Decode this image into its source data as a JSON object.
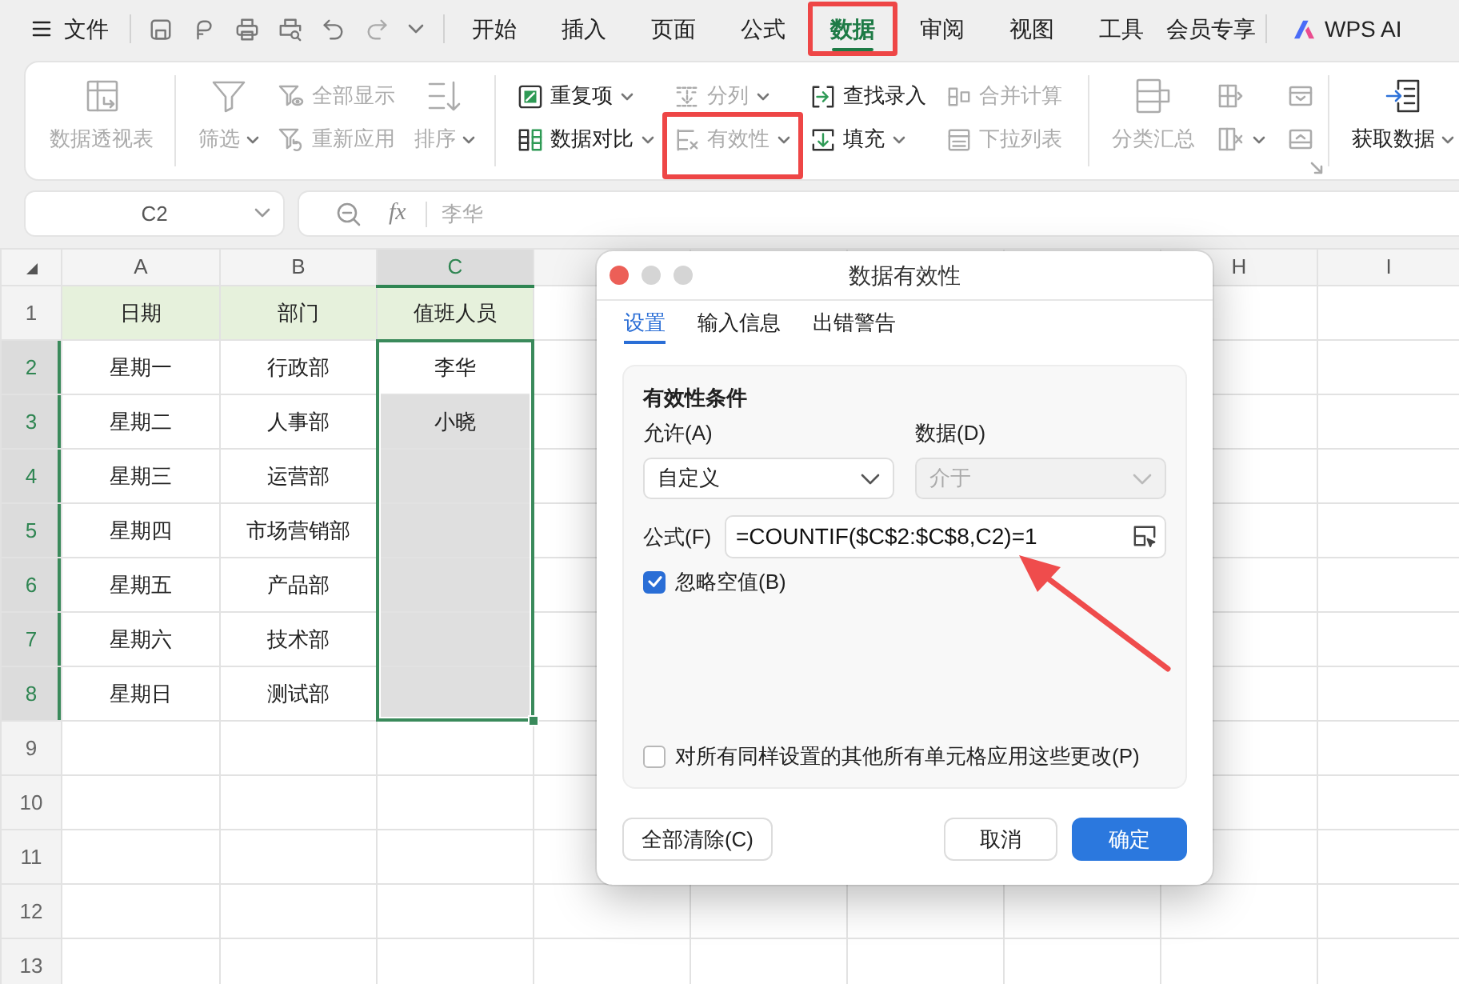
{
  "menu_bar": {
    "file_label": "文件",
    "tabs": [
      {
        "label": "开始",
        "selected": false,
        "highlighted": false
      },
      {
        "label": "插入",
        "selected": false,
        "highlighted": false
      },
      {
        "label": "页面",
        "selected": false,
        "highlighted": false
      },
      {
        "label": "公式",
        "selected": false,
        "highlighted": false
      },
      {
        "label": "数据",
        "selected": true,
        "highlighted": true
      },
      {
        "label": "审阅",
        "selected": false,
        "highlighted": false
      },
      {
        "label": "视图",
        "selected": false,
        "highlighted": false
      },
      {
        "label": "工具",
        "selected": false,
        "highlighted": false
      },
      {
        "label": "会员专享",
        "selected": false,
        "highlighted": false
      }
    ],
    "ai_label": "WPS AI"
  },
  "ribbon": {
    "groups": [
      {
        "launcher": false,
        "columns": [
          {
            "kind": "large",
            "items": [
              {
                "label": "数据透视表",
                "disabled": true,
                "has_menu": false,
                "highlighted": false
              }
            ]
          }
        ]
      },
      {
        "launcher": false,
        "columns": [
          {
            "kind": "large",
            "items": [
              {
                "label": "筛选",
                "disabled": true,
                "has_menu": true,
                "highlighted": false
              }
            ]
          },
          {
            "kind": "stack",
            "items": [
              {
                "label": "全部显示",
                "disabled": true,
                "has_menu": false,
                "highlighted": false
              },
              {
                "label": "重新应用",
                "disabled": true,
                "has_menu": false,
                "highlighted": false
              }
            ]
          },
          {
            "kind": "large",
            "items": [
              {
                "label": "排序",
                "disabled": true,
                "has_menu": true,
                "highlighted": false
              }
            ]
          }
        ]
      },
      {
        "launcher": false,
        "columns": [
          {
            "kind": "stack",
            "items": [
              {
                "label": "重复项",
                "disabled": false,
                "has_menu": true,
                "highlighted": false
              },
              {
                "label": "数据对比",
                "disabled": false,
                "has_menu": true,
                "highlighted": false
              }
            ]
          },
          {
            "kind": "stack",
            "items": [
              {
                "label": "分列",
                "disabled": true,
                "has_menu": true,
                "highlighted": false
              },
              {
                "label": "有效性",
                "disabled": true,
                "has_menu": true,
                "highlighted": true
              }
            ]
          },
          {
            "kind": "stack",
            "items": [
              {
                "label": "查找录入",
                "disabled": false,
                "has_menu": false,
                "highlighted": false
              },
              {
                "label": "填充",
                "disabled": false,
                "has_menu": true,
                "highlighted": false
              }
            ]
          },
          {
            "kind": "stack",
            "items": [
              {
                "label": "合并计算",
                "disabled": true,
                "has_menu": false,
                "highlighted": false
              },
              {
                "label": "下拉列表",
                "disabled": true,
                "has_menu": false,
                "highlighted": false
              }
            ]
          }
        ]
      },
      {
        "launcher": true,
        "columns": [
          {
            "kind": "large",
            "items": [
              {
                "label": "分类汇总",
                "disabled": true,
                "has_menu": false,
                "highlighted": false
              }
            ]
          },
          {
            "kind": "stack",
            "items": [
              {
                "disabled": true,
                "has_menu": false,
                "highlighted": false
              },
              {
                "disabled": true,
                "has_menu": true,
                "highlighted": false
              }
            ]
          },
          {
            "kind": "stack",
            "items": [
              {
                "disabled": true,
                "has_menu": false,
                "highlighted": false
              },
              {
                "disabled": true,
                "has_menu": false,
                "highlighted": false
              }
            ]
          }
        ]
      },
      {
        "launcher": false,
        "columns": [
          {
            "kind": "large",
            "items": [
              {
                "label": "获取数据",
                "disabled": false,
                "has_menu": true,
                "highlighted": false
              }
            ]
          }
        ]
      }
    ]
  },
  "name_box": {
    "value": "C2"
  },
  "formula_bar": {
    "function_label": "fx",
    "value": "李华"
  },
  "grid": {
    "columns": [
      {
        "label": "A",
        "selected": false
      },
      {
        "label": "B",
        "selected": false
      },
      {
        "label": "C",
        "selected": true
      },
      {
        "selected": false
      },
      {
        "selected": false
      },
      {
        "selected": false
      },
      {
        "selected": false
      },
      {
        "label": "H",
        "selected": false
      },
      {
        "label": "I",
        "selected": false
      }
    ],
    "header_row": {
      "number": "1",
      "selected": false,
      "cells": [
        "日期",
        "部门",
        "值班人员"
      ]
    },
    "rows": [
      {
        "number": "2",
        "selected": true,
        "cells": [
          "星期一",
          "行政部",
          "李华"
        ]
      },
      {
        "number": "3",
        "selected": true,
        "cells": [
          "星期二",
          "人事部",
          "小晓"
        ]
      },
      {
        "number": "4",
        "selected": true,
        "cells": [
          "星期三",
          "运营部"
        ]
      },
      {
        "number": "5",
        "selected": true,
        "cells": [
          "星期四",
          "市场营销部"
        ]
      },
      {
        "number": "6",
        "selected": true,
        "cells": [
          "星期五",
          "产品部"
        ]
      },
      {
        "number": "7",
        "selected": true,
        "cells": [
          "星期六",
          "技术部"
        ]
      },
      {
        "number": "8",
        "selected": true,
        "cells": [
          "星期日",
          "测试部"
        ]
      },
      {
        "number": "9",
        "selected": false
      },
      {
        "number": "10",
        "selected": false
      },
      {
        "number": "11",
        "selected": false
      },
      {
        "number": "12",
        "selected": false
      },
      {
        "number": "13",
        "selected": false
      }
    ]
  },
  "dialog": {
    "title": "数据有效性",
    "tabs": [
      {
        "label": "设置",
        "selected": true
      },
      {
        "label": "输入信息",
        "selected": false
      },
      {
        "label": "出错警告",
        "selected": false
      }
    ],
    "section_title": "有效性条件",
    "allow": {
      "label": "允许(A)",
      "value": "自定义",
      "disabled": false
    },
    "data": {
      "label": "数据(D)",
      "value": "介于",
      "disabled": true
    },
    "formula": {
      "label": "公式(F)",
      "value": "=COUNTIF($C$2:$C$8,C2)=1",
      "arrow_annotation": true
    },
    "options": [
      {
        "label": "忽略空值(B)",
        "checked": true
      },
      {
        "label": "对所有同样设置的其他所有单元格应用这些更改(P)",
        "checked": false
      }
    ],
    "buttons": [
      {
        "label": "全部清除(C)",
        "kind": "secondary"
      },
      {
        "label": "取消",
        "kind": "secondary"
      },
      {
        "label": "确定",
        "kind": "primary"
      }
    ]
  }
}
